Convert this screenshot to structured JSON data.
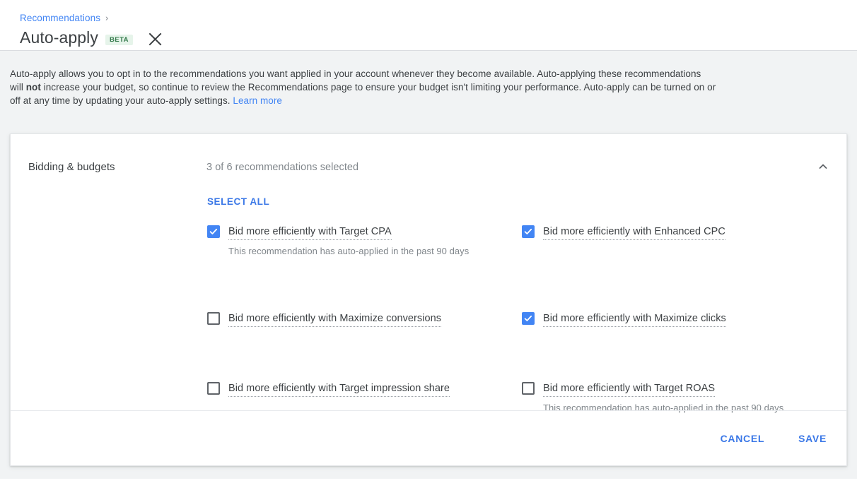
{
  "header": {
    "breadcrumb_label": "Recommendations",
    "breadcrumb_separator": "›",
    "title": "Auto-apply",
    "badge": "BETA",
    "close_icon": "close-icon"
  },
  "intro": {
    "part1": "Auto-apply allows you to opt in to the recommendations you want applied in your account whenever they become available. Auto-applying these recommendations will ",
    "bold": "not",
    "part2": " increase your budget, so continue to review the Recommendations page to ensure your budget isn't limiting your performance. Auto-apply can be turned on or off at any time by updating your auto-apply settings. ",
    "link_label": "Learn more"
  },
  "card": {
    "section_title": "Bidding & budgets",
    "summary": "3 of 6 recommendations selected",
    "collapse_icon": "chevron-up-icon",
    "select_all_label": "SELECT ALL",
    "recommendations": [
      {
        "label": "Bid more efficiently with Target CPA",
        "checked": true,
        "note": "This recommendation has auto-applied in the past 90 days"
      },
      {
        "label": "Bid more efficiently with Enhanced CPC",
        "checked": true,
        "note": ""
      },
      {
        "label": "Bid more efficiently with Maximize conversions",
        "checked": false,
        "note": ""
      },
      {
        "label": "Bid more efficiently with Maximize clicks",
        "checked": true,
        "note": ""
      },
      {
        "label": "Bid more efficiently with Target impression share",
        "checked": false,
        "note": ""
      },
      {
        "label": "Bid more efficiently with Target ROAS",
        "checked": false,
        "note": "This recommendation has auto-applied in the past 90 days"
      }
    ],
    "cancel_label": "CANCEL",
    "save_label": "SAVE"
  },
  "colors": {
    "accent_blue": "#4285f4",
    "link_blue": "#3b78e7",
    "text_primary": "#3c4043",
    "text_secondary": "#80868b",
    "badge_bg": "#e6f4ea",
    "badge_text": "#34794b",
    "page_bg": "#f1f3f4"
  }
}
